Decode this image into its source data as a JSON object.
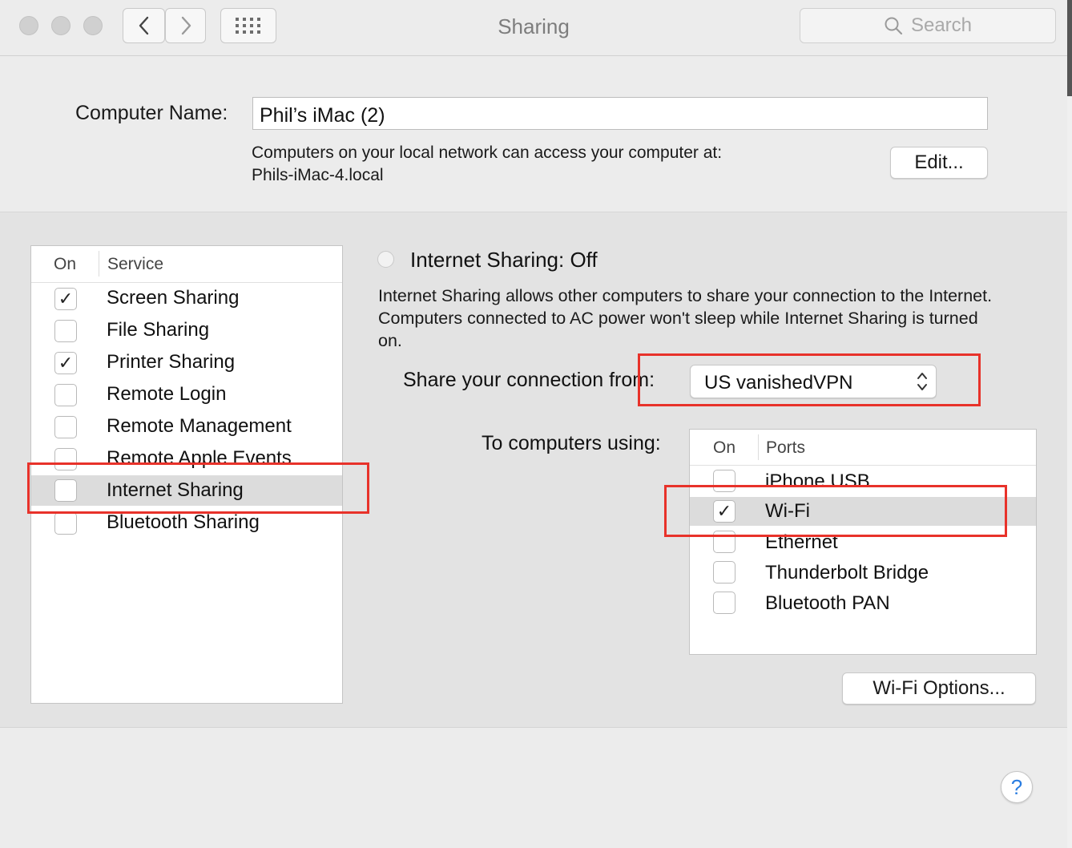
{
  "window": {
    "title": "Sharing",
    "search_placeholder": "Search",
    "controls": [
      "close",
      "minimize",
      "zoom"
    ],
    "nav_icons": [
      "back-chevron-icon",
      "forward-chevron-icon",
      "grid-icon"
    ]
  },
  "computer": {
    "label": "Computer Name:",
    "name": "Phil’s iMac (2)",
    "note_line1": "Computers on your local network can access your computer at:",
    "note_line2": "Phils-iMac-4.local",
    "edit_label": "Edit..."
  },
  "services": {
    "col_on": "On",
    "col_service": "Service",
    "items": [
      {
        "label": "Screen Sharing",
        "checked": true
      },
      {
        "label": "File Sharing",
        "checked": false
      },
      {
        "label": "Printer Sharing",
        "checked": true
      },
      {
        "label": "Remote Login",
        "checked": false
      },
      {
        "label": "Remote Management",
        "checked": false
      },
      {
        "label": "Remote Apple Events",
        "checked": false
      },
      {
        "label": "Internet Sharing",
        "checked": false,
        "selected": true
      },
      {
        "label": "Bluetooth Sharing",
        "checked": false
      }
    ]
  },
  "internet_sharing": {
    "status": "Internet Sharing: Off",
    "description": "Internet Sharing allows other computers to share your connection to the Internet. Computers connected to AC power won't sleep while Internet Sharing is turned on.",
    "share_from_label": "Share your connection from:",
    "share_from_value": "US vanishedVPN",
    "to_label": "To computers using:",
    "ports_col_on": "On",
    "ports_col_ports": "Ports",
    "ports": [
      {
        "label": "iPhone USB",
        "checked": false
      },
      {
        "label": "Wi-Fi",
        "checked": true,
        "selected": true
      },
      {
        "label": "Ethernet",
        "checked": false
      },
      {
        "label": "Thunderbolt Bridge",
        "checked": false
      },
      {
        "label": "Bluetooth PAN",
        "checked": false
      }
    ],
    "wifi_options_label": "Wi-Fi Options..."
  },
  "help_label": "?",
  "colors": {
    "annotation_red": "#e8322a",
    "help_blue": "#2a7de1",
    "selection_gray": "#dcdcdc"
  },
  "checkmark_glyph": "✓"
}
